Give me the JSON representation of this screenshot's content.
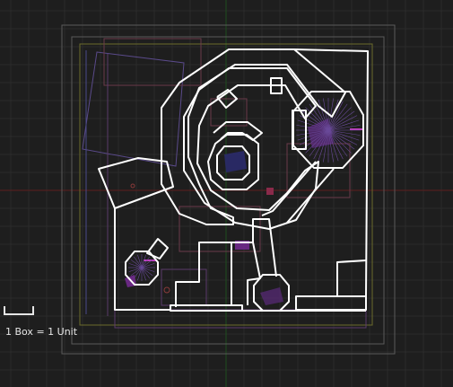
{
  "viewport": {
    "background": "#1e1e1e",
    "grid_color": "#2b2b2b",
    "axis_x_color": "#6a1f1f",
    "axis_y_color": "#1f5a1f"
  },
  "scale": {
    "label": "1 Box = 1 Unit"
  },
  "map": {
    "wall_color": "#ffffff",
    "detail_colors": [
      "#7a4a9a",
      "#8a3a3a",
      "#8a8a3a",
      "#c040c0"
    ]
  }
}
